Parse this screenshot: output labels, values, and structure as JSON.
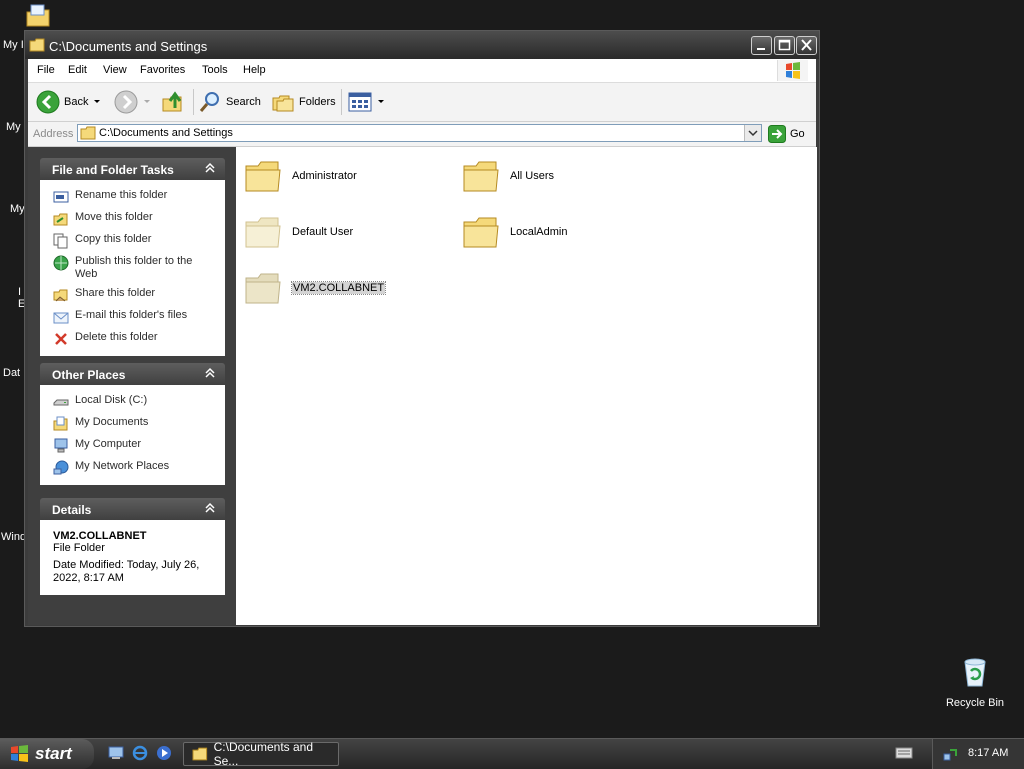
{
  "desktop": {
    "labels": [
      "My I",
      "My",
      "My",
      "I",
      "E",
      "Dat",
      "Wind"
    ],
    "recycle_bin": "Recycle Bin"
  },
  "window": {
    "title": "C:\\Documents and Settings",
    "menu": [
      "File",
      "Edit",
      "View",
      "Favorites",
      "Tools",
      "Help"
    ],
    "toolbar": {
      "back": "Back",
      "search": "Search",
      "folders": "Folders"
    },
    "address": {
      "label": "Address",
      "value": "C:\\Documents and Settings",
      "go": "Go"
    }
  },
  "tasks_panel": {
    "title": "File and Folder Tasks",
    "items": [
      {
        "label": "Rename this folder",
        "icon": "rename-icon"
      },
      {
        "label": "Move this folder",
        "icon": "move-icon"
      },
      {
        "label": "Copy this folder",
        "icon": "copy-icon"
      },
      {
        "label": "Publish this folder to the Web",
        "icon": "globe-icon"
      },
      {
        "label": "Share this folder",
        "icon": "share-icon"
      },
      {
        "label": "E-mail this folder's files",
        "icon": "email-icon"
      },
      {
        "label": "Delete this folder",
        "icon": "delete-icon"
      }
    ]
  },
  "places_panel": {
    "title": "Other Places",
    "items": [
      {
        "label": "Local Disk (C:)",
        "icon": "drive-icon"
      },
      {
        "label": "My Documents",
        "icon": "documents-icon"
      },
      {
        "label": "My Computer",
        "icon": "computer-icon"
      },
      {
        "label": "My Network Places",
        "icon": "network-icon"
      }
    ]
  },
  "details_panel": {
    "title": "Details",
    "name": "VM2.COLLABNET",
    "type": "File Folder",
    "modified": "Date Modified: Today, July 26, 2022, 8:17 AM"
  },
  "folders": [
    {
      "label": "Administrator",
      "faded": false,
      "selected": false
    },
    {
      "label": "All Users",
      "faded": false,
      "selected": false
    },
    {
      "label": "Default User",
      "faded": true,
      "selected": false
    },
    {
      "label": "LocalAdmin",
      "faded": false,
      "selected": false
    },
    {
      "label": "VM2.COLLABNET",
      "faded": true,
      "selected": true
    }
  ],
  "taskbar": {
    "start": "start",
    "task_button": "C:\\Documents and Se...",
    "clock": "8:17 AM"
  },
  "colors": {
    "folder": "#f5d97a",
    "folder_faded": "#efe6c2",
    "back_green": "#3aa33a"
  }
}
